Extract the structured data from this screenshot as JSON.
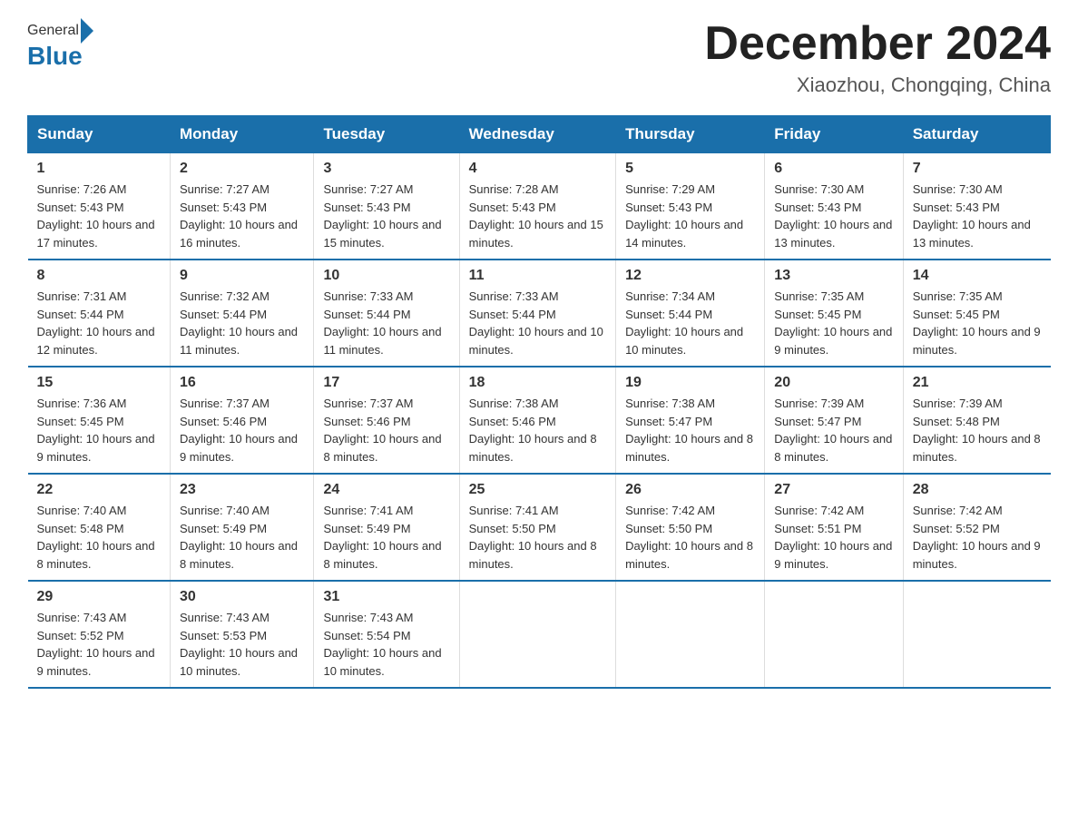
{
  "logo": {
    "general": "General",
    "blue": "Blue"
  },
  "title": "December 2024",
  "location": "Xiaozhou, Chongqing, China",
  "headers": [
    "Sunday",
    "Monday",
    "Tuesday",
    "Wednesday",
    "Thursday",
    "Friday",
    "Saturday"
  ],
  "weeks": [
    [
      {
        "day": "1",
        "sunrise": "7:26 AM",
        "sunset": "5:43 PM",
        "daylight": "10 hours and 17 minutes."
      },
      {
        "day": "2",
        "sunrise": "7:27 AM",
        "sunset": "5:43 PM",
        "daylight": "10 hours and 16 minutes."
      },
      {
        "day": "3",
        "sunrise": "7:27 AM",
        "sunset": "5:43 PM",
        "daylight": "10 hours and 15 minutes."
      },
      {
        "day": "4",
        "sunrise": "7:28 AM",
        "sunset": "5:43 PM",
        "daylight": "10 hours and 15 minutes."
      },
      {
        "day": "5",
        "sunrise": "7:29 AM",
        "sunset": "5:43 PM",
        "daylight": "10 hours and 14 minutes."
      },
      {
        "day": "6",
        "sunrise": "7:30 AM",
        "sunset": "5:43 PM",
        "daylight": "10 hours and 13 minutes."
      },
      {
        "day": "7",
        "sunrise": "7:30 AM",
        "sunset": "5:43 PM",
        "daylight": "10 hours and 13 minutes."
      }
    ],
    [
      {
        "day": "8",
        "sunrise": "7:31 AM",
        "sunset": "5:44 PM",
        "daylight": "10 hours and 12 minutes."
      },
      {
        "day": "9",
        "sunrise": "7:32 AM",
        "sunset": "5:44 PM",
        "daylight": "10 hours and 11 minutes."
      },
      {
        "day": "10",
        "sunrise": "7:33 AM",
        "sunset": "5:44 PM",
        "daylight": "10 hours and 11 minutes."
      },
      {
        "day": "11",
        "sunrise": "7:33 AM",
        "sunset": "5:44 PM",
        "daylight": "10 hours and 10 minutes."
      },
      {
        "day": "12",
        "sunrise": "7:34 AM",
        "sunset": "5:44 PM",
        "daylight": "10 hours and 10 minutes."
      },
      {
        "day": "13",
        "sunrise": "7:35 AM",
        "sunset": "5:45 PM",
        "daylight": "10 hours and 9 minutes."
      },
      {
        "day": "14",
        "sunrise": "7:35 AM",
        "sunset": "5:45 PM",
        "daylight": "10 hours and 9 minutes."
      }
    ],
    [
      {
        "day": "15",
        "sunrise": "7:36 AM",
        "sunset": "5:45 PM",
        "daylight": "10 hours and 9 minutes."
      },
      {
        "day": "16",
        "sunrise": "7:37 AM",
        "sunset": "5:46 PM",
        "daylight": "10 hours and 9 minutes."
      },
      {
        "day": "17",
        "sunrise": "7:37 AM",
        "sunset": "5:46 PM",
        "daylight": "10 hours and 8 minutes."
      },
      {
        "day": "18",
        "sunrise": "7:38 AM",
        "sunset": "5:46 PM",
        "daylight": "10 hours and 8 minutes."
      },
      {
        "day": "19",
        "sunrise": "7:38 AM",
        "sunset": "5:47 PM",
        "daylight": "10 hours and 8 minutes."
      },
      {
        "day": "20",
        "sunrise": "7:39 AM",
        "sunset": "5:47 PM",
        "daylight": "10 hours and 8 minutes."
      },
      {
        "day": "21",
        "sunrise": "7:39 AM",
        "sunset": "5:48 PM",
        "daylight": "10 hours and 8 minutes."
      }
    ],
    [
      {
        "day": "22",
        "sunrise": "7:40 AM",
        "sunset": "5:48 PM",
        "daylight": "10 hours and 8 minutes."
      },
      {
        "day": "23",
        "sunrise": "7:40 AM",
        "sunset": "5:49 PM",
        "daylight": "10 hours and 8 minutes."
      },
      {
        "day": "24",
        "sunrise": "7:41 AM",
        "sunset": "5:49 PM",
        "daylight": "10 hours and 8 minutes."
      },
      {
        "day": "25",
        "sunrise": "7:41 AM",
        "sunset": "5:50 PM",
        "daylight": "10 hours and 8 minutes."
      },
      {
        "day": "26",
        "sunrise": "7:42 AM",
        "sunset": "5:50 PM",
        "daylight": "10 hours and 8 minutes."
      },
      {
        "day": "27",
        "sunrise": "7:42 AM",
        "sunset": "5:51 PM",
        "daylight": "10 hours and 9 minutes."
      },
      {
        "day": "28",
        "sunrise": "7:42 AM",
        "sunset": "5:52 PM",
        "daylight": "10 hours and 9 minutes."
      }
    ],
    [
      {
        "day": "29",
        "sunrise": "7:43 AM",
        "sunset": "5:52 PM",
        "daylight": "10 hours and 9 minutes."
      },
      {
        "day": "30",
        "sunrise": "7:43 AM",
        "sunset": "5:53 PM",
        "daylight": "10 hours and 10 minutes."
      },
      {
        "day": "31",
        "sunrise": "7:43 AM",
        "sunset": "5:54 PM",
        "daylight": "10 hours and 10 minutes."
      },
      {
        "day": "",
        "sunrise": "",
        "sunset": "",
        "daylight": ""
      },
      {
        "day": "",
        "sunrise": "",
        "sunset": "",
        "daylight": ""
      },
      {
        "day": "",
        "sunrise": "",
        "sunset": "",
        "daylight": ""
      },
      {
        "day": "",
        "sunrise": "",
        "sunset": "",
        "daylight": ""
      }
    ]
  ]
}
